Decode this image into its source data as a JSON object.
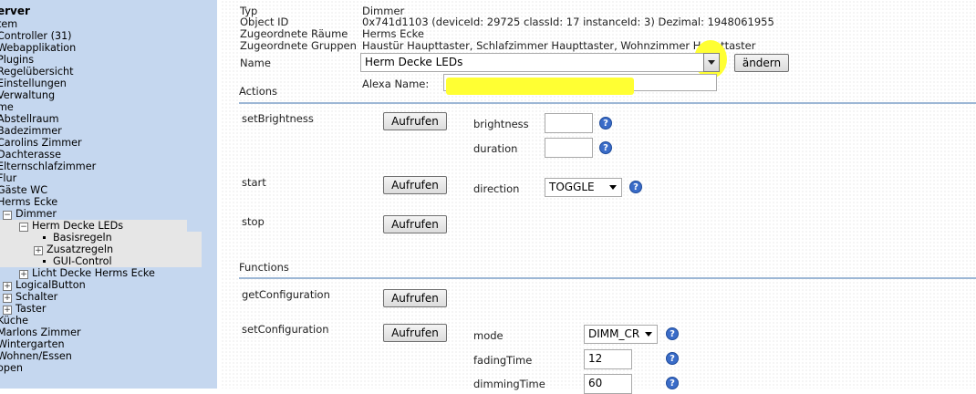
{
  "sidebar": {
    "items": [
      {
        "label": "erver",
        "indent": 0,
        "bold": true
      },
      {
        "label": "tem",
        "indent": 0
      },
      {
        "label": "Controller (31)",
        "indent": 0
      },
      {
        "label": "Webapplikation",
        "indent": 0
      },
      {
        "label": "Plugins",
        "indent": 0
      },
      {
        "label": "Regelübersicht",
        "indent": 0
      },
      {
        "label": "Einstellungen",
        "indent": 0
      },
      {
        "label": "Verwaltung",
        "indent": 0
      },
      {
        "label": "me",
        "indent": 0
      },
      {
        "label": "Abstellraum",
        "indent": 0
      },
      {
        "label": "Badezimmer",
        "indent": 0
      },
      {
        "label": "Carolins Zimmer",
        "indent": 0
      },
      {
        "label": "Dachterasse",
        "indent": 0
      },
      {
        "label": "Elternschlafzimmer",
        "indent": 0
      },
      {
        "label": "Flur",
        "indent": 0
      },
      {
        "label": "Gäste WC",
        "indent": 0
      },
      {
        "label": "Herms Ecke",
        "indent": 0
      },
      {
        "label": "Dimmer",
        "indent": 1,
        "expander": "minus"
      },
      {
        "label": "Herm Decke LEDs",
        "indent": 2,
        "expander": "minus",
        "selected": true
      },
      {
        "label": "Basisregeln",
        "indent": 3,
        "bullet": true,
        "selected": true
      },
      {
        "label": "Zusatzregeln",
        "indent": 3,
        "expander": "plus",
        "selected": true
      },
      {
        "label": "GUI-Control",
        "indent": 3,
        "bullet": true,
        "selected": true
      },
      {
        "label": "Licht Decke Herms Ecke",
        "indent": 2,
        "expander": "plus"
      },
      {
        "label": "LogicalButton",
        "indent": 1,
        "expander": "plus"
      },
      {
        "label": "Schalter",
        "indent": 1,
        "expander": "plus"
      },
      {
        "label": "Taster",
        "indent": 1,
        "expander": "plus"
      },
      {
        "label": "Küche",
        "indent": 0
      },
      {
        "label": "Marlons Zimmer",
        "indent": 0
      },
      {
        "label": "Wintergarten",
        "indent": 0
      },
      {
        "label": "Wohnen/Essen",
        "indent": 0
      },
      {
        "label": "open",
        "indent": 0
      }
    ]
  },
  "props": {
    "typ_label": "Typ",
    "typ_value": "Dimmer",
    "objid_label": "Object ID",
    "objid_value": "0x741d1103 (deviceId: 29725 classId: 17 instanceId: 3) Dezimal: 1948061955",
    "rooms_label": "Zugeordnete Räume",
    "rooms_value": "Herms Ecke",
    "groups_label": "Zugeordnete Gruppen",
    "groups_value": "Haustür Haupttaster, Schlafzimmer Haupttaster, Wohnzimmer Haupttaster",
    "name_label": "Name",
    "name_value": "Herm Decke LEDs",
    "change_button": "ändern",
    "alexa_label": "Alexa Name:",
    "alexa_value": ""
  },
  "actions": {
    "title": "Actions",
    "call_label": "Aufrufen",
    "setBrightness": {
      "name": "setBrightness",
      "p1_label": "brightness",
      "p1_value": "",
      "p2_label": "duration",
      "p2_value": ""
    },
    "start": {
      "name": "start",
      "p1_label": "direction",
      "p1_value": "TOGGLE"
    },
    "stop": {
      "name": "stop"
    }
  },
  "functions": {
    "title": "Functions",
    "getConfiguration": {
      "name": "getConfiguration"
    },
    "setConfiguration": {
      "name": "setConfiguration",
      "mode_label": "mode",
      "mode_value": "DIMM_CR",
      "fading_label": "fadingTime",
      "fading_value": "12",
      "dimming_label": "dimmingTime",
      "dimming_value": "60"
    }
  },
  "icons": {
    "help": "help-icon",
    "dropdown": "chevron-down-icon",
    "plus": "expand-plus-icon",
    "minus": "collapse-minus-icon"
  },
  "colors": {
    "sidebar_bg": "#c5d7ef",
    "help_blue": "#3a6cc8",
    "highlight": "#ffff33"
  }
}
